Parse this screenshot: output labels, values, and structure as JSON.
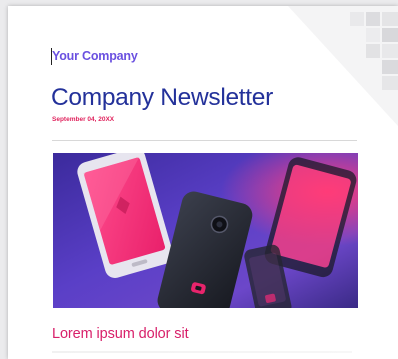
{
  "newsletter": {
    "company": "Your Company",
    "title": "Company Newsletter",
    "date": "September 04, 20XX",
    "section_heading": "Lorem ipsum dolor sit"
  },
  "colors": {
    "company": "#6a50e0",
    "title": "#23319a",
    "date": "#e0245e",
    "section_heading": "#d8206a",
    "corner_squares": "#e4e4e6"
  },
  "hero_image": {
    "description_icon": "smartphones-photo"
  }
}
